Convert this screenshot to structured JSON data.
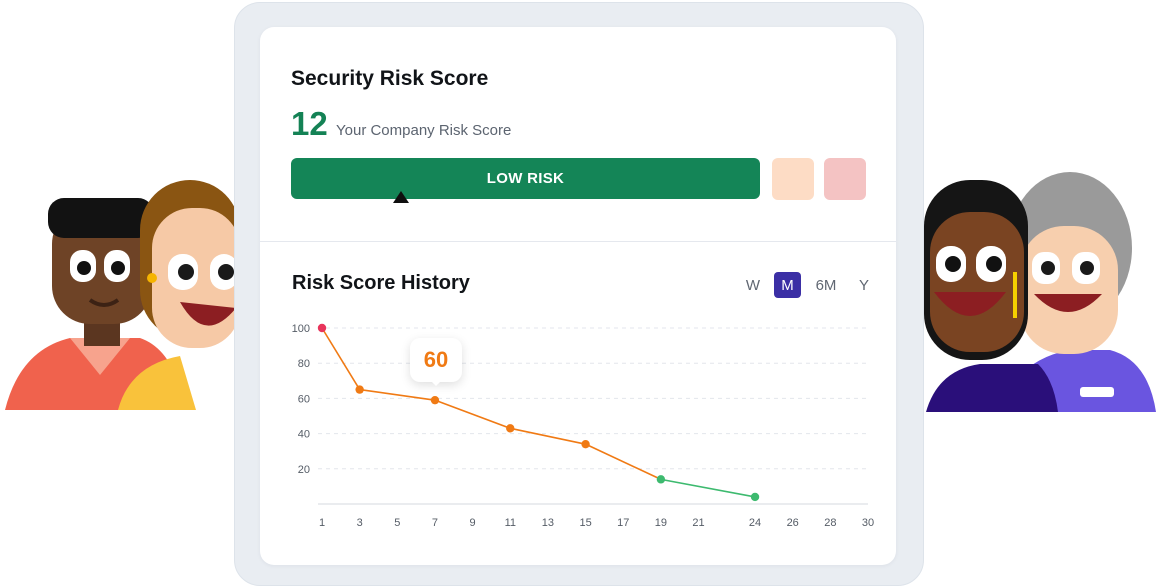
{
  "risk_card": {
    "title": "Security Risk Score",
    "score": "12",
    "score_caption": "Your Company Risk Score",
    "level_label": "LOW RISK",
    "colors": {
      "low": "#148557",
      "medium": "#fddcc5",
      "high": "#f4c3c3",
      "score_text": "#148255"
    }
  },
  "history": {
    "title": "Risk Score History",
    "ranges": [
      "W",
      "M",
      "6M",
      "Y"
    ],
    "selected_range": "M",
    "highlight_value": "60"
  },
  "chart_data": {
    "type": "line",
    "title": "Risk Score History",
    "xlabel": "",
    "ylabel": "",
    "x_ticks": [
      1,
      3,
      5,
      7,
      9,
      11,
      13,
      15,
      17,
      19,
      21,
      24,
      26,
      28,
      30
    ],
    "y_ticks": [
      20,
      40,
      60,
      80,
      100
    ],
    "ylim": [
      0,
      100
    ],
    "grid": true,
    "series": [
      {
        "points": [
          {
            "x": 1,
            "y": 100
          },
          {
            "x": 3,
            "y": 65
          },
          {
            "x": 7,
            "y": 59
          },
          {
            "x": 11,
            "y": 43
          },
          {
            "x": 15,
            "y": 34
          },
          {
            "x": 19,
            "y": 14
          },
          {
            "x": 24,
            "y": 4
          }
        ],
        "point_colors": [
          "#e8345b",
          "#f07a14",
          "#f07a14",
          "#f07a14",
          "#f07a14",
          "#3dba6f",
          "#3dba6f"
        ],
        "line_colors": [
          "#f07a14",
          "#f07a14",
          "#f07a14",
          "#f07a14",
          "#f07a14",
          "#3dba6f"
        ]
      }
    ],
    "highlight_index": 2
  }
}
